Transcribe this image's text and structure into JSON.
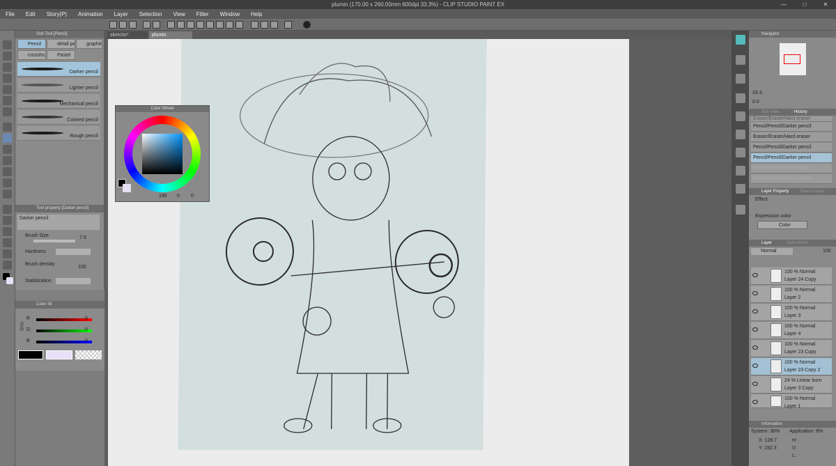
{
  "window": {
    "title": "plumin (170.00 x 260.00mm 600dpi 33.3%)  - CLIP STUDIO PAINT EX"
  },
  "menu": [
    "File",
    "Edit",
    "Story(P)",
    "Animation",
    "Layer",
    "Selection",
    "View",
    "Filter",
    "Window",
    "Help"
  ],
  "doc_tabs": [
    "sketchs*",
    "plumin"
  ],
  "subtool": {
    "title": "Sub Tool [Pencil]",
    "tabs": [
      "Pencil",
      "detail pe",
      "graphite",
      "crosshs",
      "Pastel"
    ],
    "brushes": [
      "Darker pencil",
      "Lighter pencil",
      "Mechanical pencil",
      "Colored pencil",
      "Rough pencil"
    ]
  },
  "toolprop": {
    "title": "Tool property [Darker pencil]",
    "brush_name": "Darker pencil",
    "brush_size_label": "Brush Size",
    "brush_size_value": "7.9",
    "hardness_label": "Hardness",
    "density_label": "Brush density",
    "density_value": "100",
    "stabilization_label": "Stabilization"
  },
  "colorslider": {
    "title": "Color Sli",
    "channels": [
      {
        "label": "R",
        "value": "0"
      },
      {
        "label": "G",
        "value": "0"
      },
      {
        "label": "B",
        "value": "0"
      }
    ],
    "side_label": "RGB"
  },
  "colorwheel": {
    "title": "Color Wheel",
    "values": [
      "195",
      "0",
      "0"
    ]
  },
  "navigator": {
    "title": "Navigator",
    "zoom": "33.3",
    "angle": "0.0"
  },
  "history": {
    "tabs": [
      "Sub View",
      "History"
    ],
    "items": [
      {
        "label": "Eraser/Eraser/Hard eraser",
        "state": "normal"
      },
      {
        "label": "Pencil/Pencil/Darker pencil",
        "state": "normal"
      },
      {
        "label": "Eraser/Eraser/Hard eraser",
        "state": "normal"
      },
      {
        "label": "Pencil/Pencil/Darker pencil",
        "state": "normal"
      },
      {
        "label": "Pencil/Pencil/Darker pencil",
        "state": "selected"
      },
      {
        "label": "Eraser/Eraser/Hard eraser",
        "state": "dim"
      },
      {
        "label": "Pencil/Pencil/Darker pencil",
        "state": "dim"
      }
    ]
  },
  "layer_property": {
    "title": "Layer Property",
    "tab2": "Search Layer",
    "effect_label": "Effect",
    "expression_label": "Expression color",
    "expression_value": "Color"
  },
  "layers": {
    "tabs": [
      "Layer",
      "Auto Action"
    ],
    "blend": "Normal",
    "opacity": "100",
    "items": [
      {
        "opacity": "100 %",
        "blend": "Normal",
        "name": "Layer 24 Copy",
        "selected": false
      },
      {
        "opacity": "100 %",
        "blend": "Normal",
        "name": "Layer 2",
        "selected": false
      },
      {
        "opacity": "100 %",
        "blend": "Normal",
        "name": "Layer 3",
        "selected": false
      },
      {
        "opacity": "100 %",
        "blend": "Normal",
        "name": "Layer 4",
        "selected": false
      },
      {
        "opacity": "100 %",
        "blend": "Normal",
        "name": "Layer 23 Copy",
        "selected": false
      },
      {
        "opacity": "100 %",
        "blend": "Normal",
        "name": "Layer 23 Copy 2",
        "selected": true
      },
      {
        "opacity": "24 %",
        "blend": "Linear burn",
        "name": "Layer 3 Copy",
        "selected": false
      },
      {
        "opacity": "100 %",
        "blend": "Normal",
        "name": "Layer 1",
        "selected": false
      }
    ]
  },
  "info": {
    "title": "Information",
    "system": "System: 36%",
    "application": "Application: 8%",
    "x": "X: 128.7",
    "y": "Y: 192.3",
    "h": "H:",
    "v": "V:",
    "l": "L:"
  },
  "colors": {
    "accent_selected": "#a3c5db",
    "toolbar": "#6e6e6e",
    "panel": "#8b8b8b"
  }
}
